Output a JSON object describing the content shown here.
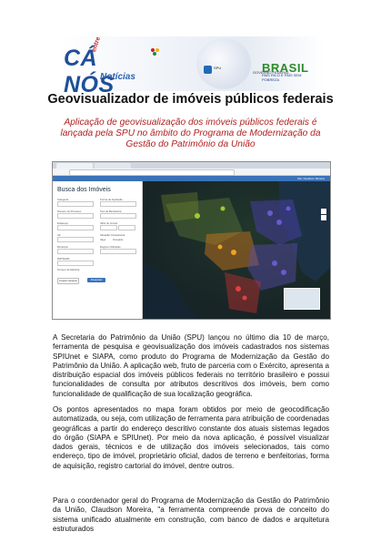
{
  "header": {
    "logo": {
      "main": "CÁ NÓS",
      "vertical": "entre",
      "sub": "Notícias"
    },
    "partners": {
      "spu": "SPU",
      "gov_label": "GOVERNO FEDERAL",
      "country": "BRASIL",
      "tagline": "PAÍS RICO É PAÍS SEM POBREZA"
    },
    "colors": {
      "brand_blue": "#1e4f99",
      "brand_red": "#cc2222",
      "brasil_green": "#2c8a2c"
    }
  },
  "article": {
    "title": "Geovisualizador de imóveis públicos federais",
    "subtitle": "Aplicação de geovisualização dos imóveis públicos federais é lançada pela SPU no âmbito do Programa de Modernização da Gestão do Patrimônio da União",
    "subtitle_color": "#b22020",
    "paragraphs": [
      "A Secretaria do Patrimônio da União (SPU) lançou no último dia 10 de março, ferramenta de pesquisa e geovisualização dos imóveis cadastrados nos sistemas SPIUnet e SIAPA, como produto do Programa de Modernização da Gestão do Patrimônio da União. A aplicação web, fruto de parceria com o Exército, apresenta a distribuição espacial dos imóveis públicos federais no território brasileiro e possui funcionalidades de consulta por atributos descritivos dos imóveis, bem como funcionalidade de qualificação de sua localização geográfica.",
      "Os pontos apresentados no mapa foram obtidos por meio de geocodificação automatizada, ou seja, com utilização de ferramenta para atribuição de coordenadas geográficas a partir do endereço descritivo constante dos atuais sistemas legados do órgão (SIAPA e SPIUnet). Por meio da nova aplicação, é possível visualizar dados gerais, técnicos e de utilização dos imóveis selecionados, tais como endereço, tipo de imóvel, proprietário oficial, dados de terreno e benfeitorias, forma de aquisição, registro cartorial do imóvel, dentre outros.",
      "Para o coordenador geral do Programa de Modernização da Gestão do Patrimônio da União, Claudson Moreira, \"a ferramenta compreende prova de conceito do sistema unificado atualmente em construção, com banco de dados e arquitetura estruturados"
    ]
  },
  "screenshot": {
    "panel_title": "Busca dos Imóveis",
    "user_label": "Olá, Claudson Moreira",
    "fields": [
      "Categoria",
      "Forma de Aquisição",
      "Número do Processo",
      "Tipo de Benfeitoria",
      "Endereço",
      "Valor do Imóvel",
      "UF",
      "Situação Ocupacional",
      "Município",
      "Regime Utilização",
      "RIP/SIAPA"
    ],
    "radio_options": [
      "Vago",
      "Ocupado"
    ],
    "checkbox": "Terreno de Marinha",
    "buttons": {
      "clear": "Limpar Campos",
      "search": "Pesquisar"
    }
  }
}
